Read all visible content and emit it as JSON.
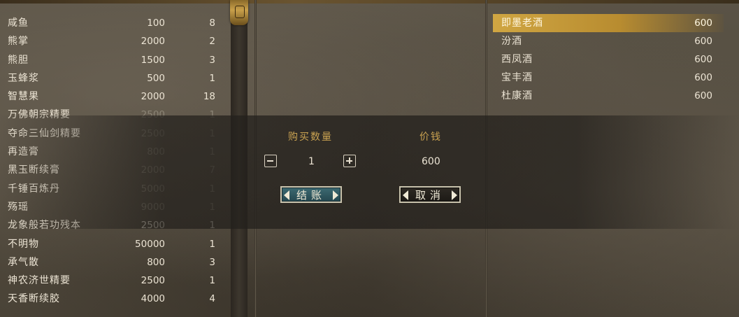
{
  "inventory": {
    "items": [
      {
        "name": "咸鱼",
        "price": "100",
        "qty": "8",
        "dim": false
      },
      {
        "name": "熊掌",
        "price": "2000",
        "qty": "2",
        "dim": false
      },
      {
        "name": "熊胆",
        "price": "1500",
        "qty": "3",
        "dim": false
      },
      {
        "name": "玉蜂浆",
        "price": "500",
        "qty": "1",
        "dim": false
      },
      {
        "name": "智慧果",
        "price": "2000",
        "qty": "18",
        "dim": false
      },
      {
        "name": "万佛朝宗精要",
        "price": "2500",
        "qty": "1",
        "dim": true
      },
      {
        "name": "夺命三仙剑精要",
        "price": "2500",
        "qty": "1",
        "dim": true
      },
      {
        "name": "再造膏",
        "price": "800",
        "qty": "1",
        "dim": true
      },
      {
        "name": "黑玉断续膏",
        "price": "2000",
        "qty": "7",
        "dim": true
      },
      {
        "name": "千锤百炼丹",
        "price": "5000",
        "qty": "1",
        "dim": true
      },
      {
        "name": "殇瑶",
        "price": "9000",
        "qty": "1",
        "dim": true
      },
      {
        "name": "龙象般若功残本",
        "price": "2500",
        "qty": "1",
        "dim": false
      },
      {
        "name": "不明物",
        "price": "50000",
        "qty": "1",
        "dim": false
      },
      {
        "name": "承气散",
        "price": "800",
        "qty": "3",
        "dim": false
      },
      {
        "name": "神农济世精要",
        "price": "2500",
        "qty": "1",
        "dim": false
      },
      {
        "name": "天香断续胶",
        "price": "4000",
        "qty": "4",
        "dim": false
      }
    ]
  },
  "shop": {
    "items": [
      {
        "name": "即墨老酒",
        "price": "600",
        "selected": true
      },
      {
        "name": "汾酒",
        "price": "600",
        "selected": false
      },
      {
        "name": "西凤酒",
        "price": "600",
        "selected": false
      },
      {
        "name": "宝丰酒",
        "price": "600",
        "selected": false
      },
      {
        "name": "杜康酒",
        "price": "600",
        "selected": false
      }
    ]
  },
  "dialog": {
    "quantity_label": "购买数量",
    "price_label": "价钱",
    "quantity": "1",
    "price": "600",
    "checkout_label": "结账",
    "cancel_label": "取消"
  },
  "colors": {
    "accent_gold": "#c9a251",
    "selected_highlight": "#d0a642",
    "checkout_button": "#3d6a72"
  }
}
